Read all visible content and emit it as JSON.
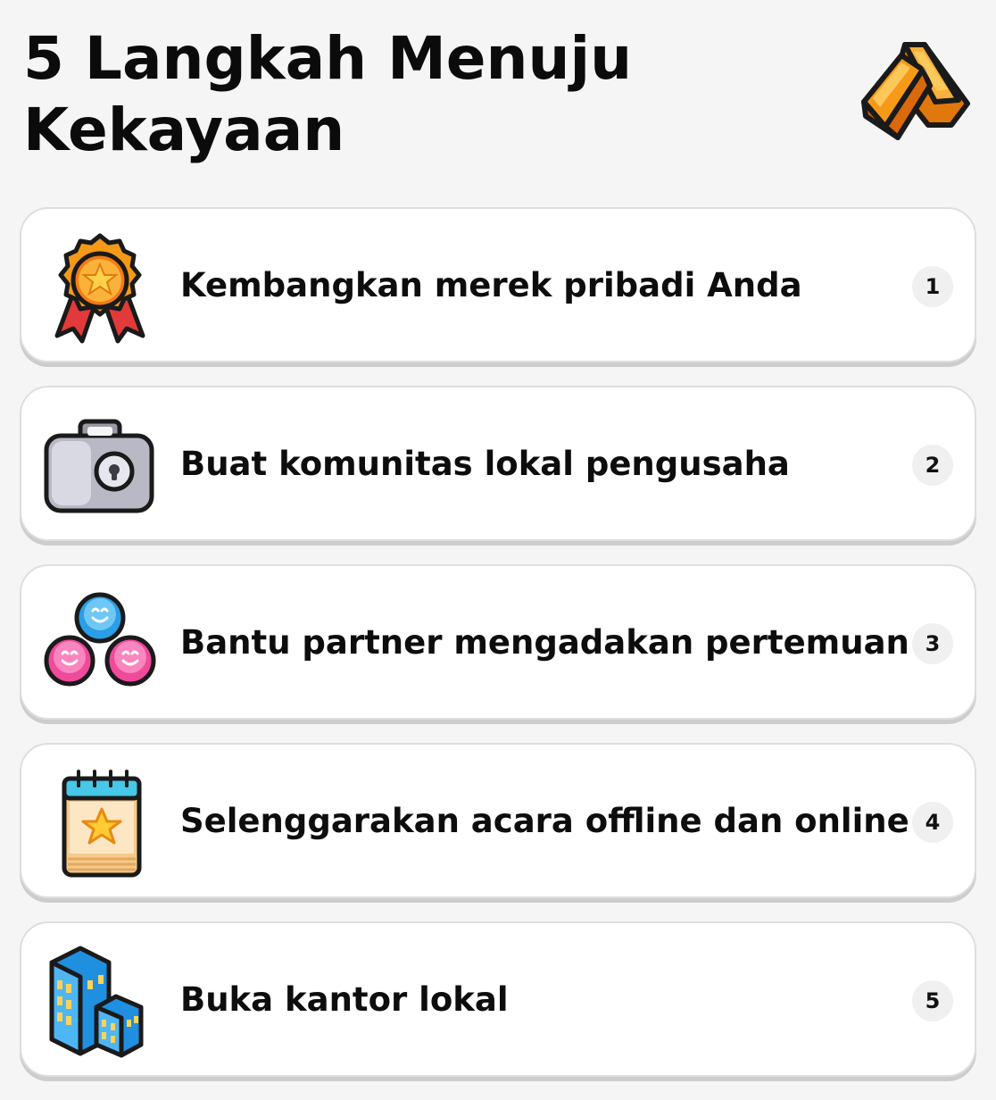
{
  "header": {
    "title": "5 Langkah Menuju Kekayaan"
  },
  "steps": [
    {
      "label": "Kembangkan merek pribadi Anda",
      "number": "1",
      "icon": "medal-icon"
    },
    {
      "label": "Buat komunitas lokal pengusaha",
      "number": "2",
      "icon": "briefcase-icon"
    },
    {
      "label": "Bantu partner mengadakan pertemuan",
      "number": "3",
      "icon": "people-group-icon"
    },
    {
      "label": "Selenggarakan acara offline dan online",
      "number": "4",
      "icon": "calendar-icon"
    },
    {
      "label": "Buka kantor lokal",
      "number": "5",
      "icon": "office-building-icon"
    }
  ],
  "colors": {
    "background": "#f5f5f5",
    "card": "#ffffff",
    "badge": "#f0f0f0",
    "gold": "#f7a21b"
  }
}
